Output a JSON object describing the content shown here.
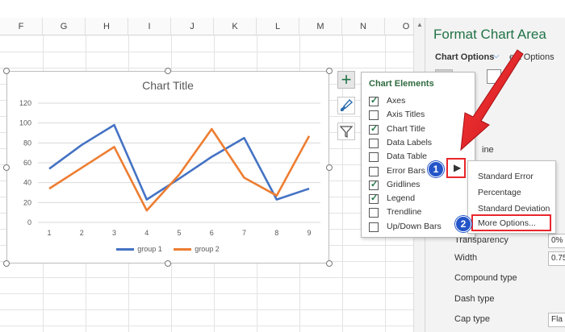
{
  "sheet": {
    "columns": [
      "F",
      "G",
      "H",
      "I",
      "J",
      "K",
      "L",
      "M",
      "N",
      "O"
    ]
  },
  "chart": {
    "title": "Chart Title",
    "legend": [
      {
        "name": "group 1",
        "color": "#4472c4"
      },
      {
        "name": "group 2",
        "color": "#ed7d31"
      }
    ]
  },
  "chart_data": {
    "type": "line",
    "title": "Chart Title",
    "x": [
      1,
      2,
      3,
      4,
      5,
      6,
      7,
      8,
      9
    ],
    "ylim": [
      0,
      120
    ],
    "yticks": [
      0,
      20,
      40,
      60,
      80,
      100,
      120
    ],
    "grid": true,
    "legend_position": "bottom",
    "series": [
      {
        "name": "group 1",
        "color": "#4472c4",
        "values": [
          54,
          78,
          98,
          23,
          44,
          66,
          85,
          23,
          34
        ]
      },
      {
        "name": "group 2",
        "color": "#ed7d31",
        "values": [
          34,
          55,
          76,
          12,
          48,
          94,
          45,
          27,
          87
        ]
      }
    ]
  },
  "side_buttons": {
    "plus_icon": "plus-icon",
    "brush_icon": "paintbrush-icon",
    "filter_icon": "filter-icon"
  },
  "chart_elements": {
    "title": "Chart Elements",
    "items": [
      {
        "label": "Axes",
        "checked": true
      },
      {
        "label": "Axis Titles",
        "checked": false
      },
      {
        "label": "Chart Title",
        "checked": true
      },
      {
        "label": "Data Labels",
        "checked": false
      },
      {
        "label": "Data Table",
        "checked": false
      },
      {
        "label": "Error Bars",
        "checked": false
      },
      {
        "label": "Gridlines",
        "checked": true
      },
      {
        "label": "Legend",
        "checked": true
      },
      {
        "label": "Trendline",
        "checked": false
      },
      {
        "label": "Up/Down Bars",
        "checked": false
      }
    ]
  },
  "error_bars_submenu": {
    "items": [
      "Standard Error",
      "Percentage",
      "Standard Deviation"
    ],
    "more": "More Options..."
  },
  "badges": {
    "one": "1",
    "two": "2"
  },
  "format_pane": {
    "title": "Format Chart Area",
    "tab_chart_options": "Chart Options",
    "tab_text_options": "ext Options",
    "line_partial": "ine",
    "rows": [
      "Transparency",
      "Width",
      "Compound type",
      "Dash type",
      "Cap type"
    ],
    "transparency_value": "0%",
    "width_value": "0.75",
    "cap_value": "Fla"
  },
  "annotation_color": "#e8262b"
}
